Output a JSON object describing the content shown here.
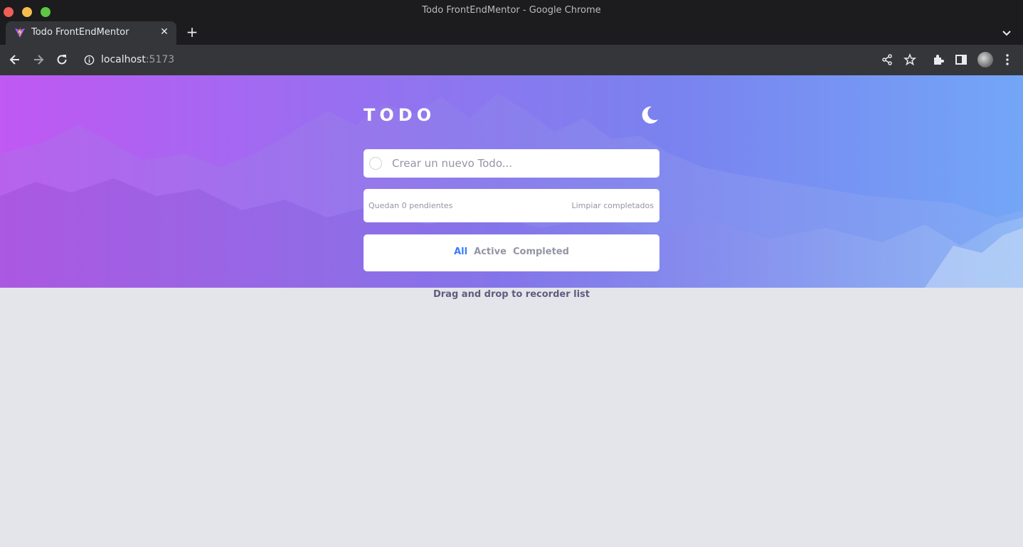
{
  "window": {
    "title": "Todo FrontEndMentor - Google Chrome"
  },
  "tab": {
    "title": "Todo FrontEndMentor",
    "close_glyph": "✕",
    "new_tab_glyph": "+"
  },
  "address_bar": {
    "host": "localhost",
    "port": ":5173"
  },
  "icons": {
    "back": "back-arrow-icon",
    "forward": "forward-arrow-icon",
    "reload": "reload-icon",
    "site_info": "info-icon",
    "share": "share-icon",
    "bookmark": "star-icon",
    "extensions": "puzzle-icon",
    "side_panel": "side-panel-icon",
    "menu": "kebab-menu-icon",
    "theme": "moon-icon",
    "tab_search": "chevron-down-icon"
  },
  "app": {
    "title": "TODO",
    "input_placeholder": "Crear un nuevo Todo...",
    "items_left": "Quedan 0 pendientes",
    "clear_completed": "Limpiar completados",
    "filters": [
      "All",
      "Active",
      "Completed"
    ],
    "active_filter": "All",
    "hint": "Drag and drop to recorder list"
  },
  "colors": {
    "gradient_start": "#c058f3",
    "gradient_end": "#73a6f7",
    "active_filter": "#3a7cfd",
    "muted_text": "#9495a5",
    "page_bg": "#e4e5ea"
  }
}
